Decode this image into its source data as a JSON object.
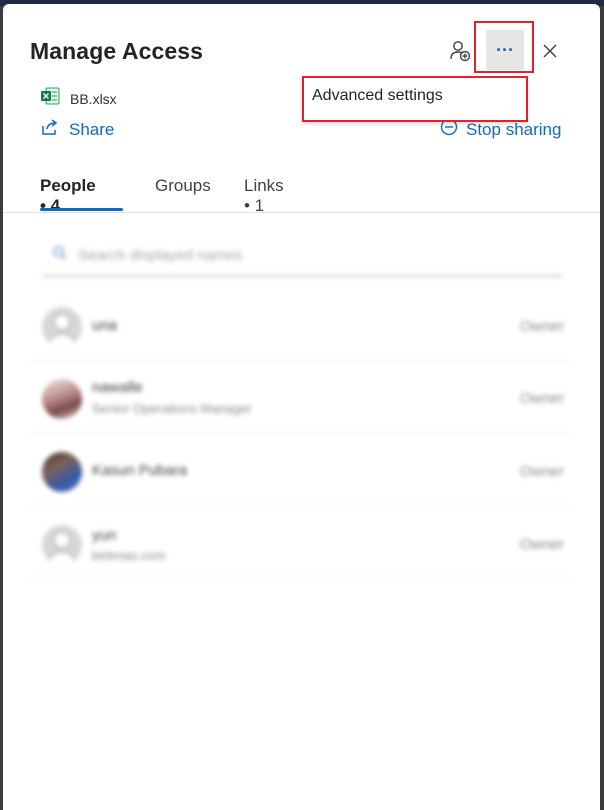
{
  "dialog": {
    "title": "Manage Access",
    "more_label": "···",
    "file_name": "BB.xlsx",
    "share_label": "Share",
    "stop_sharing_label": "Stop sharing"
  },
  "menu": {
    "items": [
      {
        "label": "Advanced settings"
      }
    ]
  },
  "tabs": [
    {
      "label": "People • 4",
      "active": true
    },
    {
      "label": "Groups",
      "active": false
    },
    {
      "label": "Links • 1",
      "active": false
    }
  ],
  "search": {
    "placeholder": "Search displayed names"
  },
  "people": [
    {
      "name": "una",
      "subtitle": "",
      "role": "Owner"
    },
    {
      "name": "nawalle",
      "subtitle": "Senior Operations Manager",
      "role": "Owner"
    },
    {
      "name": "Kasun Pubara",
      "subtitle": "",
      "role": "Owner"
    },
    {
      "name": "yun",
      "subtitle": "birtimas.com",
      "role": "Owner"
    }
  ],
  "colors": {
    "accent": "#0f6cbd",
    "highlight": "#e3212b"
  }
}
